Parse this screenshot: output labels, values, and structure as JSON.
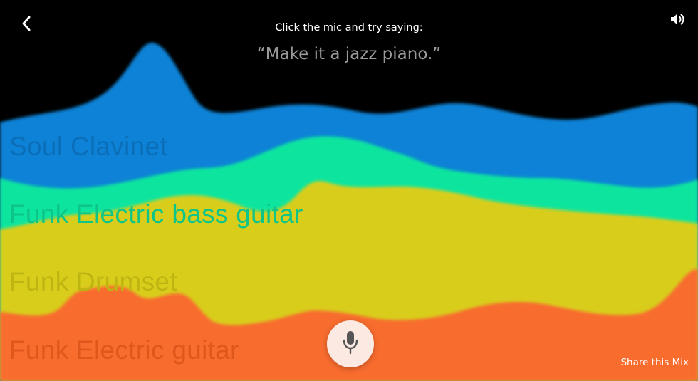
{
  "header": {
    "prompt": "Click the mic and try saying:",
    "example_phrase": "“Make it a jazz piano.”"
  },
  "tracks": [
    {
      "label": "Soul Clavinet",
      "color": "#0a82d6",
      "label_color": "#0a6fb8"
    },
    {
      "label": "Funk Electric bass guitar",
      "color": "#0ee59f",
      "label_color": "#0dc489"
    },
    {
      "label": "Funk Drumset",
      "color": "#d9cd1c",
      "label_color": "#bfb512"
    },
    {
      "label": "Funk Electric guitar",
      "color": "#f86c2f",
      "label_color": "#e0571c"
    }
  ],
  "controls": {
    "back_icon": "chevron-left-icon",
    "sound_icon": "speaker-icon",
    "mic_icon": "microphone-icon",
    "share_label": "Share this Mix"
  }
}
